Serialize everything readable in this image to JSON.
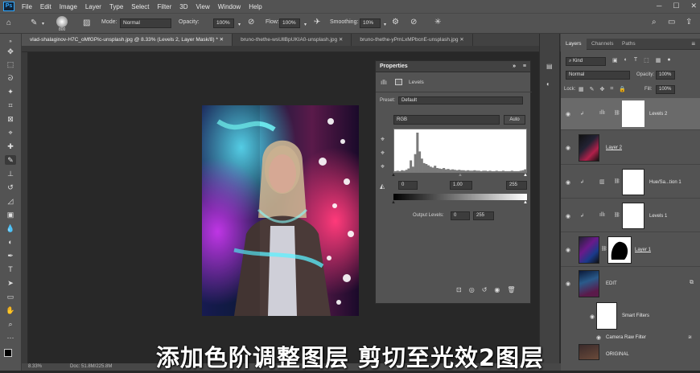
{
  "menu": {
    "logo": "Ps",
    "items": [
      "File",
      "Edit",
      "Image",
      "Layer",
      "Type",
      "Select",
      "Filter",
      "3D",
      "View",
      "Window",
      "Help"
    ]
  },
  "options": {
    "brush_size": "800",
    "mode_label": "Mode:",
    "mode_value": "Normal",
    "opacity_label": "Opacity:",
    "opacity_value": "100%",
    "flow_label": "Flow:",
    "flow_value": "100%",
    "smoothing_label": "Smoothing:",
    "smoothing_value": "10%"
  },
  "tabs": [
    "vlad-shalaginov-H7C_oMfGPIc-unsplash.jpg @ 8.33% (Levels 2, Layer Mask/8) *",
    "bruno-thethe-wsUllBpUKIA0-unsplash.jpg",
    "bruno-thethe-yPmLxMPbcnE-unsplash.jpg"
  ],
  "properties": {
    "title": "Properties",
    "panel_name": "Levels",
    "preset_label": "Preset:",
    "preset_value": "Default",
    "channel_value": "RGB",
    "auto_button": "Auto",
    "input_black": "0",
    "input_gamma": "1.00",
    "input_white": "255",
    "output_label": "Output Levels:",
    "output_black": "0",
    "output_white": "255"
  },
  "histogram": [
    2,
    3,
    2,
    4,
    3,
    5,
    8,
    26,
    12,
    40,
    88,
    46,
    30,
    20,
    18,
    15,
    12,
    10,
    14,
    9,
    8,
    7,
    9,
    6,
    7,
    5,
    6,
    5,
    4,
    5,
    4,
    4,
    3,
    4,
    3,
    3,
    4,
    3,
    3,
    2,
    3,
    3,
    2,
    3,
    2,
    2,
    3,
    2,
    2,
    3,
    2,
    2,
    2,
    3,
    2,
    2,
    2,
    3,
    4,
    6
  ],
  "layers_panel": {
    "tabs": [
      "Layers",
      "Channels",
      "Paths"
    ],
    "filter_value": "Kind",
    "blend_value": "Normal",
    "opacity_label": "Opacity:",
    "opacity_value": "100%",
    "lock_label": "Lock:",
    "fill_label": "Fill:",
    "fill_value": "100%",
    "layers": [
      {
        "name": "Levels 2"
      },
      {
        "name": "Layer 2"
      },
      {
        "name": "Hue/Sa...tion 1"
      },
      {
        "name": "Levels 1"
      },
      {
        "name": "Layer 1"
      },
      {
        "name": "EDIT"
      },
      {
        "name": "Smart Filters"
      },
      {
        "name": "Camera Raw Filter"
      },
      {
        "name": "ORIGINAL"
      }
    ]
  },
  "status": {
    "zoom": "8.33%",
    "doc": "Doc: 51.8M/225.8M"
  },
  "subtitle": "添加色阶调整图层 剪切至光效2图层",
  "colors": {
    "accent": "#31a8ff",
    "panel": "#535353",
    "dark": "#282828"
  }
}
